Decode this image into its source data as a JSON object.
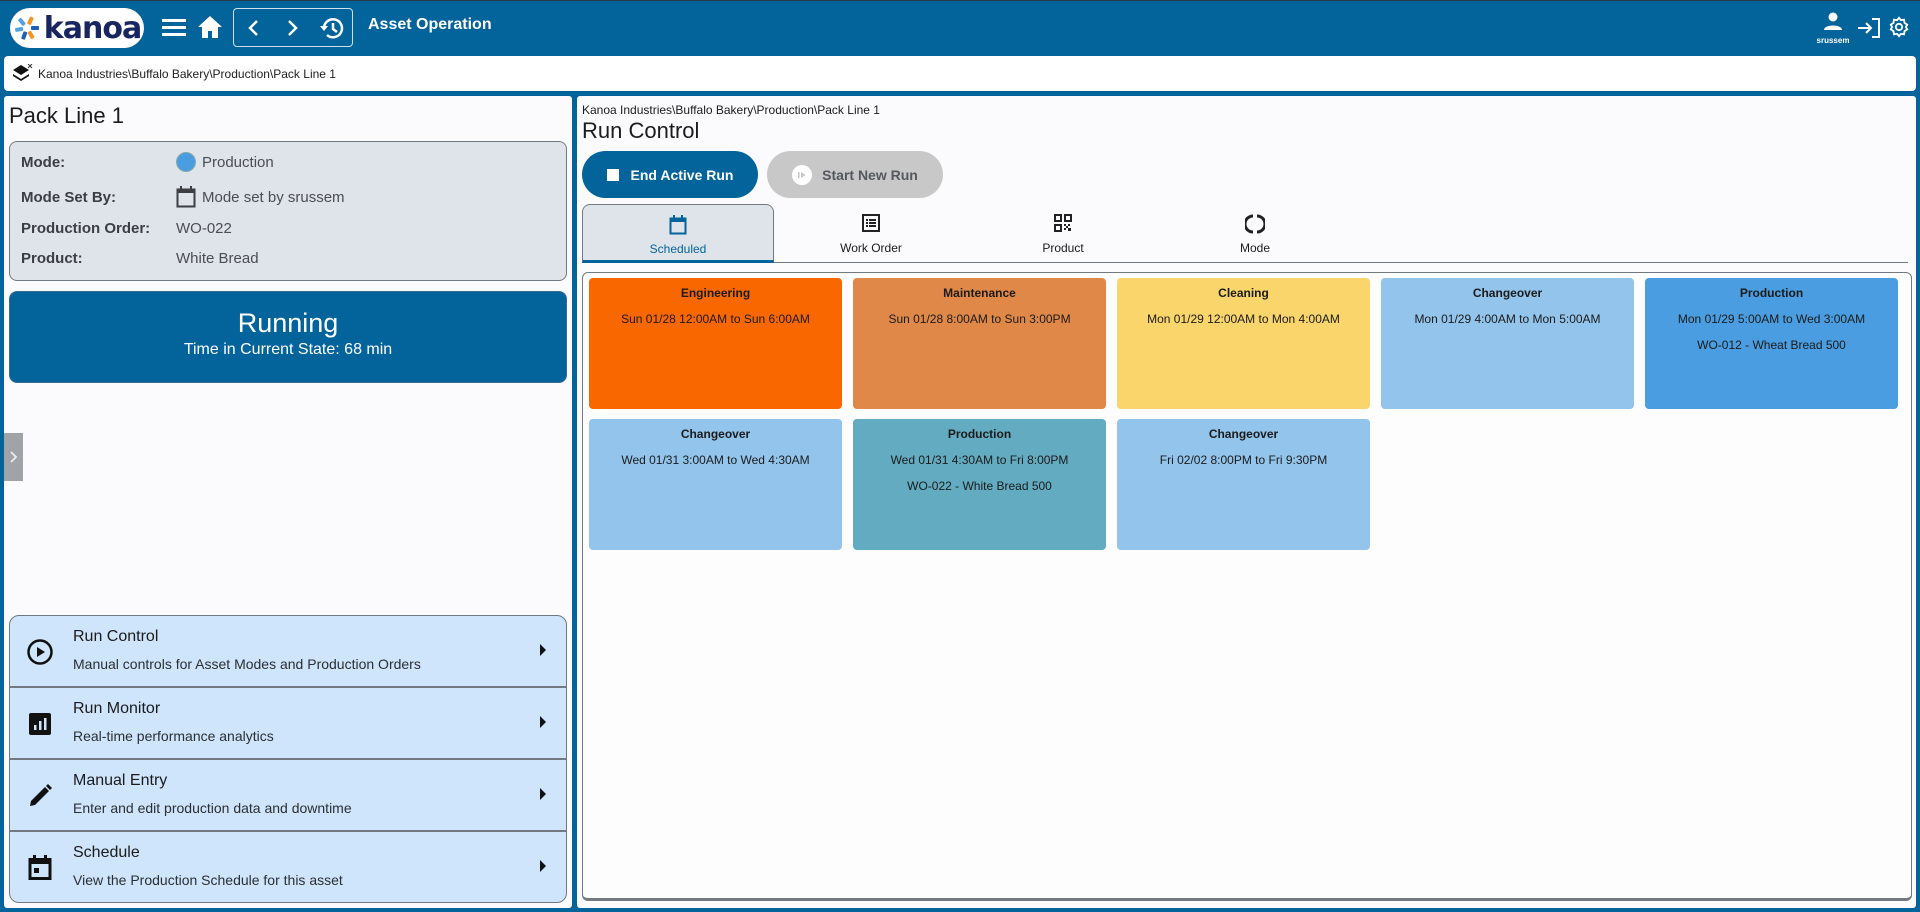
{
  "header": {
    "logo_text": "kanoa",
    "app_title": "Asset Operation",
    "username": "srussem",
    "icons": [
      "menu-icon",
      "home-icon",
      "back-icon",
      "forward-icon",
      "history-icon",
      "user-icon",
      "logout-icon",
      "settings-icon"
    ]
  },
  "breadcrumb": {
    "path": "Kanoa Industries\\Buffalo Bakery\\Production\\Pack Line 1"
  },
  "left_panel": {
    "asset_name": "Pack Line 1",
    "info": [
      {
        "label": "Mode:",
        "value": "Production",
        "icon": "mode-dot-icon"
      },
      {
        "label": "Mode Set By:",
        "value": "Mode set by srussem",
        "icon": "calendar-icon"
      },
      {
        "label": "Production Order:",
        "value": "WO-022"
      },
      {
        "label": "Product:",
        "value": "White Bread"
      }
    ],
    "mode_color": "#4a9de0",
    "state": {
      "label": "Running",
      "time_text": "Time in Current State: 68 min"
    },
    "menu": [
      {
        "title": "Run Control",
        "subtitle": "Manual controls for Asset Modes and Production Orders",
        "icon": "play-circle-icon"
      },
      {
        "title": "Run Monitor",
        "subtitle": "Real-time performance analytics",
        "icon": "analytics-icon"
      },
      {
        "title": "Manual Entry",
        "subtitle": "Enter and edit production data and downtime",
        "icon": "pencil-icon"
      },
      {
        "title": "Schedule",
        "subtitle": "View the Production Schedule for this asset",
        "icon": "calendar-icon"
      }
    ]
  },
  "right_panel": {
    "breadcrumb": "Kanoa Industries\\Buffalo Bakery\\Production\\Pack Line 1",
    "title": "Run Control",
    "end_run_label": "End Active Run",
    "start_run_label": "Start New Run",
    "tabs": [
      {
        "label": "Scheduled",
        "icon": "calendar-icon",
        "active": true
      },
      {
        "label": "Work Order",
        "icon": "list-icon",
        "active": false
      },
      {
        "label": "Product",
        "icon": "qr-code-icon",
        "active": false
      },
      {
        "label": "Mode",
        "icon": "mode-circle-icon",
        "active": false
      }
    ],
    "schedule": [
      {
        "title": "Engineering",
        "time": "Sun 01/28 12:00AM to Sun 6:00AM",
        "order": "",
        "color": "#f96700"
      },
      {
        "title": "Maintenance",
        "time": "Sun 01/28 8:00AM to Sun 3:00PM",
        "order": "",
        "color": "#e08847"
      },
      {
        "title": "Cleaning",
        "time": "Mon 01/29 12:00AM to Mon 4:00AM",
        "order": "",
        "color": "#f9d56b"
      },
      {
        "title": "Changeover",
        "time": "Mon 01/29 4:00AM to Mon 5:00AM",
        "order": "",
        "color": "#92c4ec"
      },
      {
        "title": "Production",
        "time": "Mon 01/29 5:00AM to Wed 3:00AM",
        "order": "WO-012 - Wheat Bread 500",
        "color": "#499de0"
      },
      {
        "title": "Changeover",
        "time": "Wed 01/31 3:00AM to Wed 4:30AM",
        "order": "",
        "color": "#92c4ec"
      },
      {
        "title": "Production",
        "time": "Wed 01/31 4:30AM to Fri 8:00PM",
        "order": "WO-022 - White Bread 500",
        "color": "#62abc0"
      },
      {
        "title": "Changeover",
        "time": "Fri 02/02 8:00PM to Fri 9:30PM",
        "order": "",
        "color": "#92c4ec"
      }
    ]
  },
  "colors": {
    "brand": "#03639b",
    "card_bg": "#dfe3ea",
    "menu_bg": "#cfe5fb"
  }
}
